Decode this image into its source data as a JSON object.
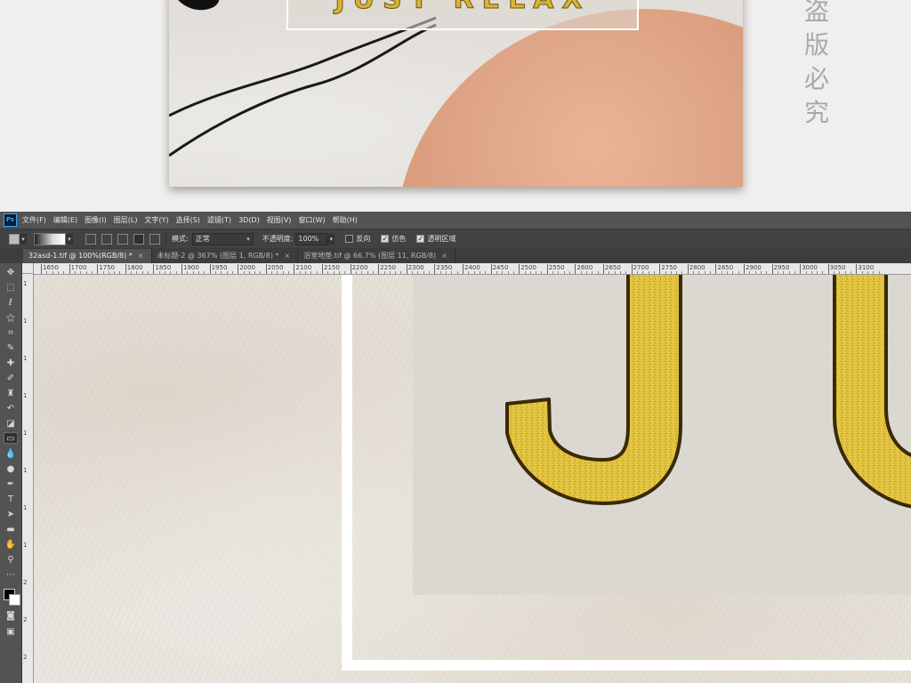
{
  "preview": {
    "artwork_title": "JUST RELAX",
    "side_note": "盗版必究"
  },
  "menu": {
    "logo": "Ps",
    "items": [
      "文件(F)",
      "编辑(E)",
      "图像(I)",
      "图层(L)",
      "文字(Y)",
      "选择(S)",
      "滤镜(T)",
      "3D(D)",
      "视图(V)",
      "窗口(W)",
      "帮助(H)"
    ]
  },
  "options": {
    "mode_label": "模式:",
    "mode_value": "正常",
    "opacity_label": "不透明度:",
    "opacity_value": "100%",
    "reverse_label": "反向",
    "dither_label": "仿色",
    "transparency_label": "透明区域"
  },
  "tabs": [
    {
      "label": "32asd-1.tif @ 100%(RGB/8) *",
      "active": true
    },
    {
      "label": "未标题-2 @ 367% (图层 1, RGB/8) *",
      "active": false
    },
    {
      "label": "浴室地垫.tif @ 66.7% (图层 11, RGB/8)",
      "active": false
    }
  ],
  "ruler": {
    "top_ticks": [
      "1650",
      "1700",
      "1750",
      "1800",
      "1850",
      "1900",
      "1950",
      "2000",
      "2050",
      "2100",
      "2150",
      "2200",
      "2250",
      "2300",
      "2350",
      "2400",
      "2450",
      "2500",
      "2550",
      "2600",
      "2650",
      "2700",
      "2750",
      "2800",
      "2850",
      "2900",
      "2950",
      "3000",
      "3050",
      "3100"
    ],
    "left_ticks": [
      "1",
      "1",
      "1",
      "1",
      "1",
      "1",
      "1",
      "1",
      "2",
      "2",
      "2"
    ]
  },
  "canvas": {
    "visible_letters": "JU"
  },
  "colors": {
    "ps_bg": "#535353",
    "gold": "#d8b436",
    "terracotta": "#d99c7d"
  }
}
